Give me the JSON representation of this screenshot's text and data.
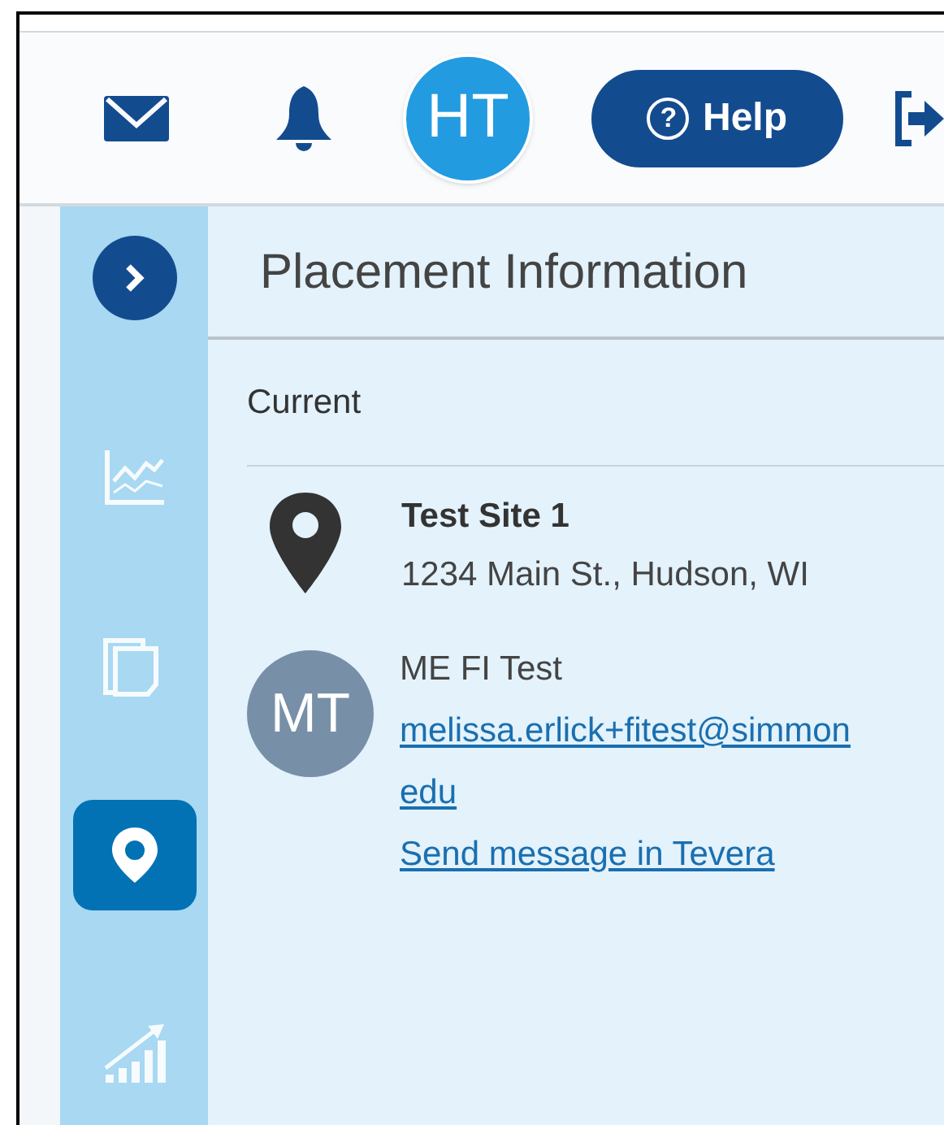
{
  "header": {
    "avatar_initials": "HT",
    "help_button": "Help",
    "help_icon": "?"
  },
  "sidebar": {
    "items": [
      {
        "kind": "chart",
        "selected": false
      },
      {
        "kind": "copy",
        "selected": false
      },
      {
        "kind": "pin",
        "selected": true
      },
      {
        "kind": "growth",
        "selected": false
      }
    ]
  },
  "panel": {
    "title": "Placement Information",
    "section": "Current",
    "site": {
      "name": "Test Site 1",
      "address": "1234 Main St., Hudson, WI"
    },
    "contact": {
      "initials": "MT",
      "name": "ME FI Test",
      "email_lines": [
        "melissa.erlick+fitest@simmon",
        "edu"
      ],
      "message_link": "Send message in Tevera"
    }
  }
}
